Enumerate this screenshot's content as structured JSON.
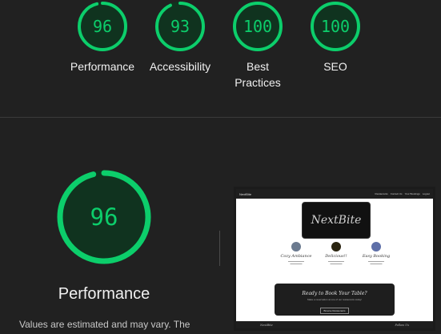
{
  "colors": {
    "pass": "#0cce6b",
    "pass_fill": "#10331f",
    "background": "#212121"
  },
  "summary": {
    "categories": [
      {
        "label": "Performance",
        "score": "96",
        "score_value": 96
      },
      {
        "label": "Accessibility",
        "score": "93",
        "score_value": 93
      },
      {
        "label": "Best Practices",
        "score": "100",
        "score_value": 100
      },
      {
        "label": "SEO",
        "score": "100",
        "score_value": 100
      }
    ]
  },
  "performance": {
    "score": "96",
    "score_value": 96,
    "title": "Performance",
    "note": "Values are estimated and may vary. The"
  },
  "screenshot": {
    "brand": "NextBite",
    "nav_links": [
      "Restaurants",
      "Contact Us",
      "Your Bookings",
      "Logout"
    ],
    "logo": "NextBite",
    "features": [
      {
        "title": "Cozy Ambiance",
        "icon": "restaurant-photo-icon"
      },
      {
        "title": "Delicious!!",
        "icon": "food-photo-icon"
      },
      {
        "title": "Easy Booking",
        "icon": "booking-photo-icon"
      }
    ],
    "cta_title": "Ready to Book Your Table?",
    "cta_sub": "Make a reservation at one of our restaurants today!",
    "cta_button": "Browse Restaurants",
    "footer_left": "NextBite",
    "footer_right": "Follow Us"
  }
}
